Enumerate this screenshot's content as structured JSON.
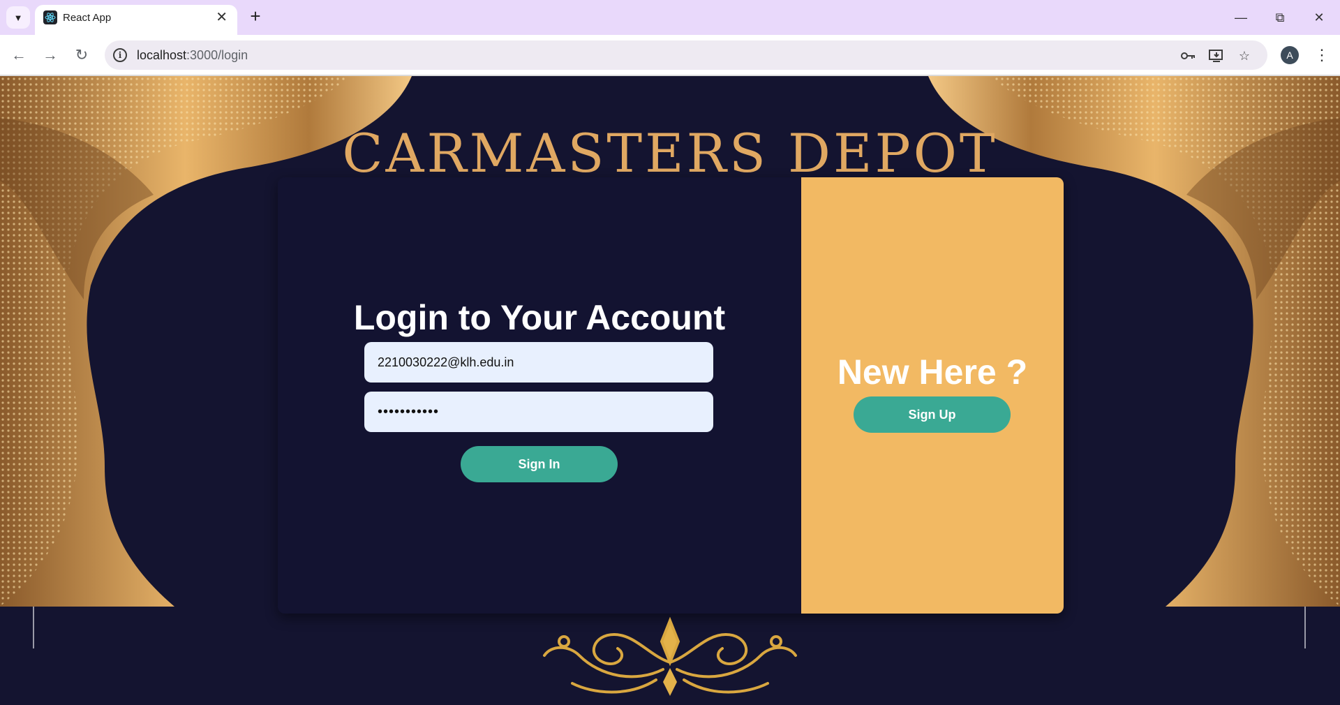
{
  "browser": {
    "tab_title": "React App",
    "url_host": "localhost",
    "url_path": ":3000/login",
    "avatar_letter": "A",
    "icons": [
      "tab-search-icon",
      "react-icon",
      "close-icon",
      "plus-icon",
      "minimize-icon",
      "restore-icon",
      "window-close-icon",
      "back-icon",
      "forward-icon",
      "reload-icon",
      "site-info-icon",
      "password-key-icon",
      "install-app-icon",
      "bookmark-star-icon",
      "menu-kebab-icon"
    ]
  },
  "page": {
    "brand": "CARMASTERS DEPOT",
    "login": {
      "title": "Login to Your Account",
      "email_value": "2210030222@klh.edu.in",
      "password_value": "•••••••••••",
      "signin_label": "Sign In"
    },
    "signup_panel": {
      "title": "New Here ?",
      "signup_label": "Sign Up"
    }
  },
  "colors": {
    "background_navy": "#141430",
    "gold": "#e0a862",
    "panel_orange": "#f2b963",
    "button_teal": "#3aa994",
    "input_bg": "#e8f0fe"
  }
}
